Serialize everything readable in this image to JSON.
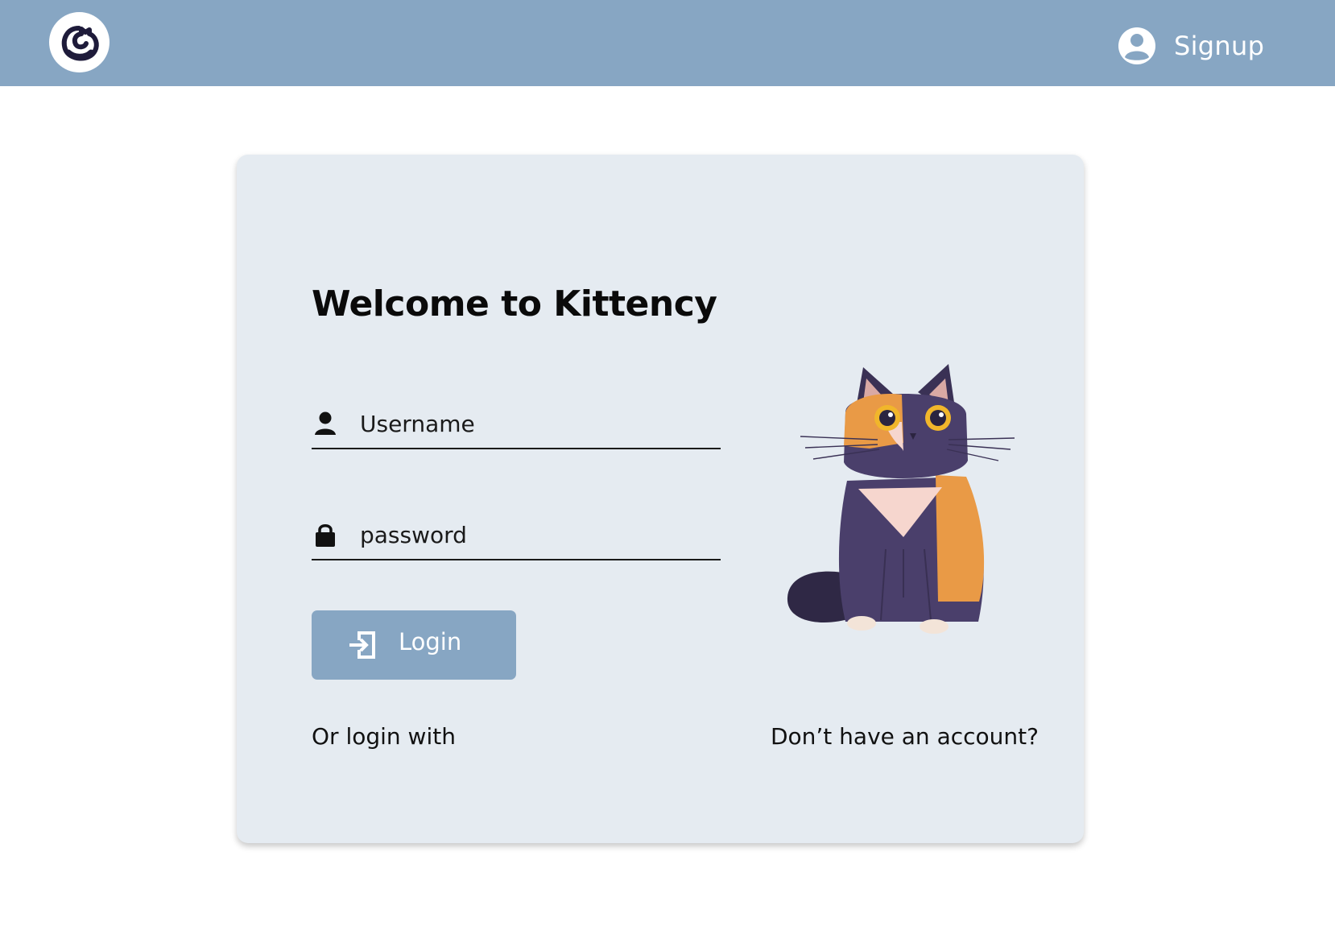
{
  "navbar": {
    "logo_icon": "cat-logo-icon",
    "signup_icon": "user-circle-icon",
    "signup_label": "Signup",
    "color": "#87a6c3"
  },
  "login_card": {
    "title": "Welcome to Kittency",
    "username": {
      "icon": "user-icon",
      "placeholder": "Username",
      "value": ""
    },
    "password": {
      "icon": "lock-icon",
      "placeholder": "password",
      "value": ""
    },
    "login_button": {
      "icon": "login-arrow-icon",
      "label": "Login"
    },
    "alt_login_label": "Or login with",
    "no_account_link": "Don’t have an account?",
    "illustration": "calico-cat-illustration",
    "background": "#e5ebf1"
  }
}
